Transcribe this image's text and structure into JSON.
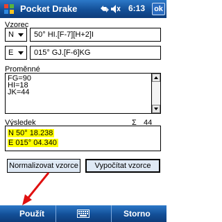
{
  "titlebar": {
    "title": "Pocket Drake",
    "time": "6:13",
    "ok_label": "ok"
  },
  "formula": {
    "label": "Vzorec",
    "lat_hemisphere": "N",
    "lat_formula": "50° HI.[F-7][H+2]I",
    "lon_hemisphere": "E",
    "lon_formula": "015° GJ.[F-6]KG"
  },
  "variables": {
    "label": "Proměnné",
    "lines": [
      "FG=90",
      "HI=18",
      "JK=44"
    ]
  },
  "result": {
    "label": "Výsledek",
    "sigma_symbol": "Σ",
    "sum": "44",
    "lat": "N  50° 18.238",
    "lon": "E  015° 04.340"
  },
  "buttons": {
    "normalize": "Normalizovat vzorce",
    "calculate": "Vypočítat vzorce"
  },
  "menubar": {
    "left": "Použít",
    "right": "Storno"
  },
  "colors": {
    "titlebar": "#134f97",
    "highlight": "#ffff00",
    "button": "#dfe9f5",
    "arrow": "#e01010"
  },
  "icons": [
    "windows-flag-icon",
    "connectivity-icon",
    "speaker-icon",
    "signal-icon",
    "keyboard-icon",
    "red-arrow-icon"
  ]
}
